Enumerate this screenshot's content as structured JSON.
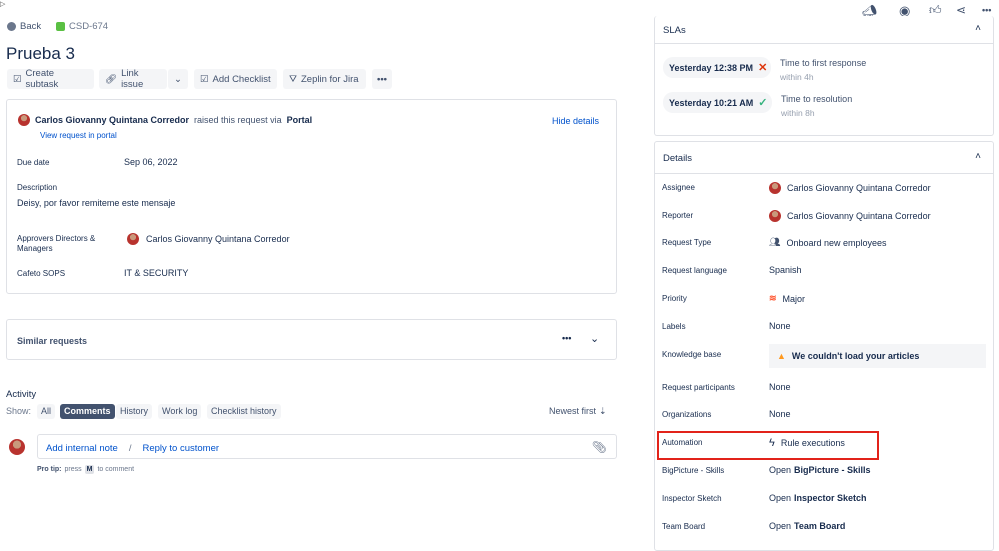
{
  "header": {
    "back": "Back",
    "issue_key": "CSD-674",
    "title": "Prueba 3"
  },
  "toolbar": {
    "create_subtask": "Create subtask",
    "link_issue": "Link issue",
    "add_checklist": "Add Checklist",
    "zeplin": "Zeplin for Jira"
  },
  "request": {
    "author": "Carlos Giovanny Quintana Corredor",
    "raised_text": "raised this request via",
    "channel": "Portal",
    "view_link": "View request in portal",
    "hide_details": "Hide details",
    "fields": [
      {
        "label": "Due date",
        "value": "Sep 06, 2022"
      },
      {
        "label": "Description",
        "value": "Deisy, por favor remiteme este mensaje"
      },
      {
        "label": "Approvers Directors & Managers",
        "value": "Carlos Giovanny Quintana Corredor"
      },
      {
        "label": "Cafeto SOPS",
        "value": "IT & SECURITY"
      }
    ]
  },
  "similar": {
    "title": "Similar requests"
  },
  "activity": {
    "title": "Activity",
    "show_label": "Show:",
    "tabs": [
      "All",
      "Comments",
      "History",
      "Work log",
      "Checklist history"
    ],
    "active_tab": "Comments",
    "sort": "Newest first",
    "add_note": "Add internal note",
    "separator": "/",
    "reply": "Reply to customer",
    "pro_tip_bold": "Pro tip:",
    "pro_tip_press": "press",
    "pro_tip_key": "M",
    "pro_tip_end": "to comment"
  },
  "slas": {
    "title": "SLAs",
    "items": [
      {
        "time": "Yesterday 12:38 PM",
        "status": "breached",
        "name": "Time to first response",
        "goal": "within 4h"
      },
      {
        "time": "Yesterday 10:21 AM",
        "status": "met",
        "name": "Time to resolution",
        "goal": "within 8h"
      }
    ]
  },
  "details": {
    "title": "Details",
    "rows": [
      {
        "label": "Assignee",
        "value": "Carlos Giovanny Quintana Corredor",
        "icon": "avatar"
      },
      {
        "label": "Reporter",
        "value": "Carlos Giovanny Quintana Corredor",
        "icon": "avatar"
      },
      {
        "label": "Request Type",
        "value": "Onboard new employees",
        "icon": "people-icon"
      },
      {
        "label": "Request language",
        "value": "Spanish"
      },
      {
        "label": "Priority",
        "value": "Major",
        "icon": "priority-major-icon"
      },
      {
        "label": "Labels",
        "value": "None"
      },
      {
        "label": "Knowledge base",
        "value": "We couldn't load your articles",
        "icon": "warning-icon"
      },
      {
        "label": "Request participants",
        "value": "None"
      },
      {
        "label": "Organizations",
        "value": "None"
      },
      {
        "label": "Automation",
        "value": "Rule executions",
        "icon": "lightning-icon"
      },
      {
        "label": "BigPicture - Skills",
        "prefix": "Open",
        "value": "BigPicture - Skills"
      },
      {
        "label": "Inspector Sketch",
        "prefix": "Open",
        "value": "Inspector Sketch"
      },
      {
        "label": "Team Board",
        "prefix": "Open",
        "value": "Team Board"
      }
    ]
  },
  "colors": {
    "highlight": "#e2231a",
    "breached": "#de350b",
    "met": "#36b37e",
    "link": "#0052cc",
    "active_tab": "#42526e"
  }
}
